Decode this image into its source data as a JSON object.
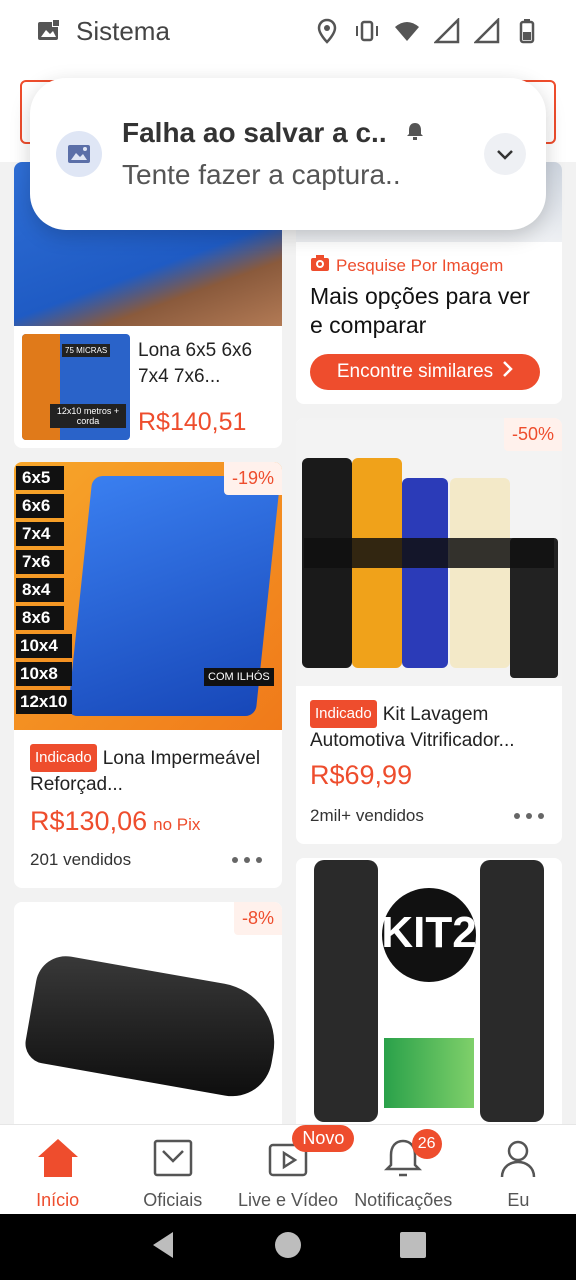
{
  "status_bar": {
    "label": "Sistema",
    "icons": [
      "image-icon",
      "location-icon",
      "vibrate-icon",
      "wifi-icon",
      "signal-icon",
      "signal-icon",
      "battery-icon"
    ]
  },
  "notification": {
    "title": "Falha ao salvar a c..",
    "body": "Tente fazer a captura..",
    "icons": [
      "screenshot-icon",
      "bell-icon",
      "chevron-down-icon"
    ]
  },
  "image_search_card": {
    "label": "Pesquise Por Imagem",
    "heading": "Mais opções para ver e comparar",
    "button": "Encontre similares"
  },
  "products": [
    {
      "name": "Lona 6x5 6x6 7x4 7x6...",
      "price": "R$140,51",
      "image_texts": [
        "75 MICRAS",
        "12x10 metros + corda"
      ]
    },
    {
      "discount": "-19%",
      "tag": "Indicado",
      "name": "Lona Impermeável Reforçad...",
      "price": "R$130,06",
      "price_suffix": "no Pix",
      "sold": "201 vendidos",
      "sizes": [
        "6x5",
        "6x6",
        "7x4",
        "7x6",
        "8x4",
        "8x6",
        "10x4",
        "10x8",
        "12x10"
      ],
      "image_caption": "COM ILHÓS"
    },
    {
      "discount": "-50%",
      "tag": "Indicado",
      "name": "Kit Lavagem Automotiva Vitrificador...",
      "price": "R$69,99",
      "sold": "2mil+ vendidos"
    },
    {
      "discount": "-8%"
    },
    {
      "image_text": "KIT2"
    }
  ],
  "bottom_nav": [
    {
      "label": "Início",
      "icon": "home-icon",
      "active": true
    },
    {
      "label": "Oficiais",
      "icon": "bag-icon"
    },
    {
      "label": "Live e Vídeo",
      "icon": "play-icon",
      "badge": "Novo"
    },
    {
      "label": "Notificações",
      "icon": "bell-icon",
      "badge": "26"
    },
    {
      "label": "Eu",
      "icon": "user-icon"
    }
  ],
  "colors": {
    "accent": "#ee4d2d",
    "background": "#f2f2f2"
  }
}
